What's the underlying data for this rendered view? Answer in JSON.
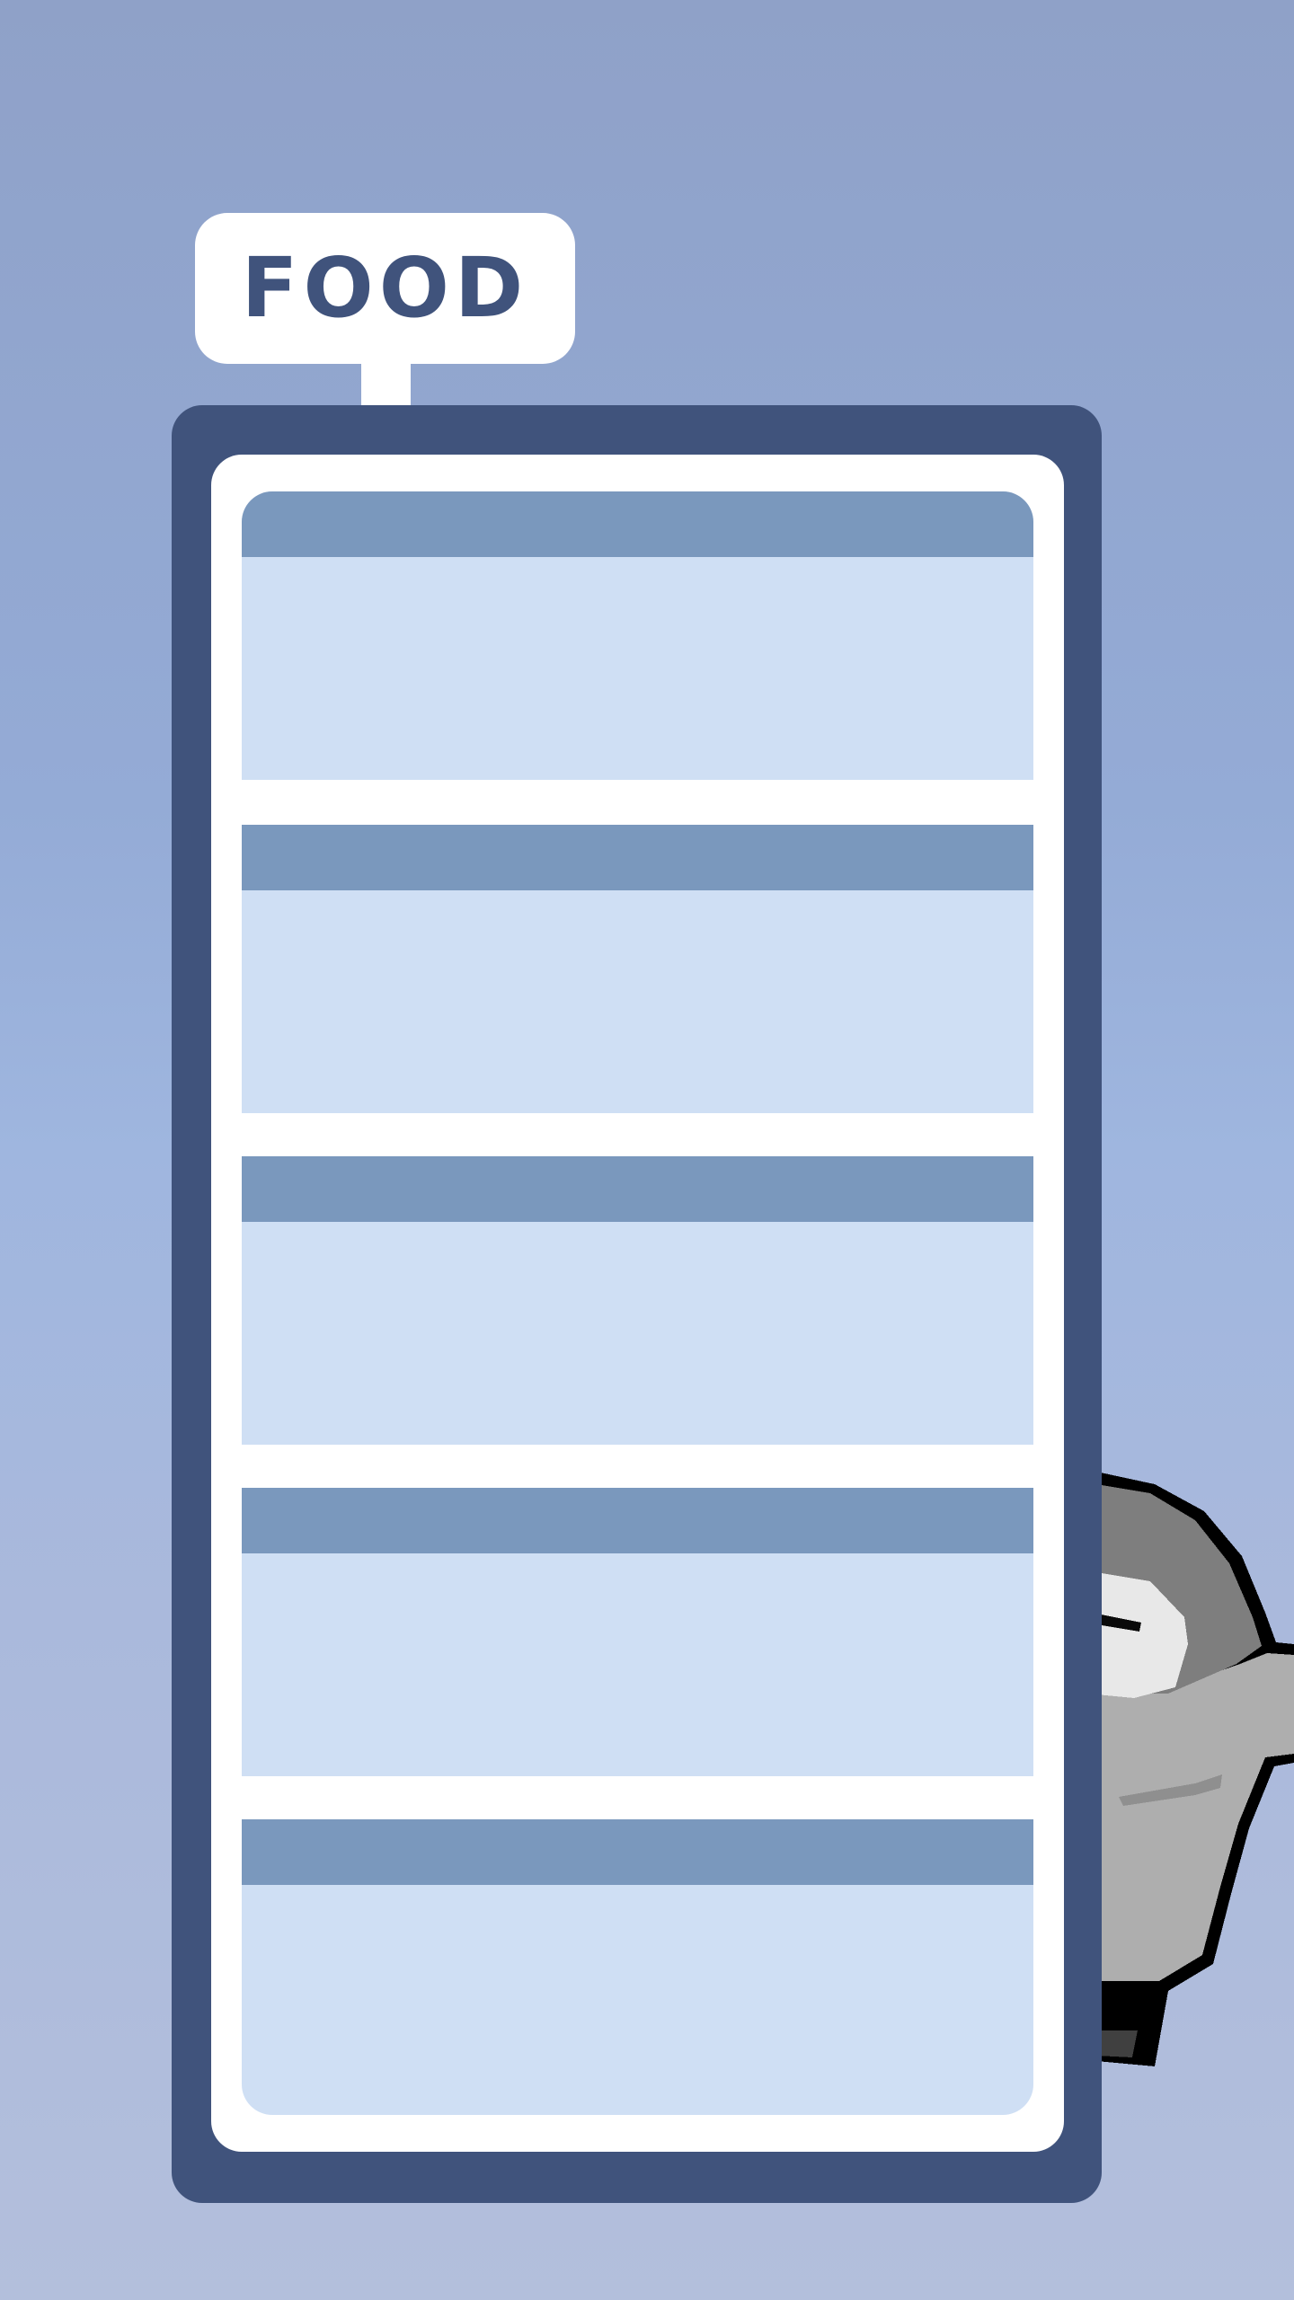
{
  "label": {
    "text": "FOOD"
  },
  "shelves": [
    {
      "slot": 1
    },
    {
      "slot": 2
    },
    {
      "slot": 3
    },
    {
      "slot": 4
    },
    {
      "slot": 5
    }
  ],
  "colors": {
    "panel": "#40537c",
    "shelf_header": "#7a98bd",
    "shelf_body": "#cfdff4",
    "label_text": "#40537c"
  }
}
